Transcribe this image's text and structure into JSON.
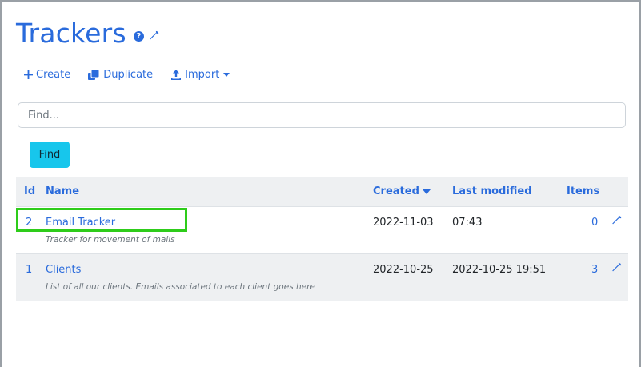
{
  "page": {
    "title": "Trackers",
    "help_icon": "question-circle-icon",
    "settings_icon": "wrench-icon"
  },
  "actions": [
    {
      "label": "Create",
      "icon": "plus-icon"
    },
    {
      "label": "Duplicate",
      "icon": "duplicate-icon"
    },
    {
      "label": "Import",
      "icon": "upload-icon"
    }
  ],
  "search": {
    "placeholder": "Find...",
    "value": ""
  },
  "find_button": {
    "label": "Find"
  },
  "table": {
    "headers": {
      "id": "Id",
      "name": "Name",
      "created": "Created",
      "last_modified": "Last modified",
      "items": "Items"
    },
    "rows": [
      {
        "id": "2",
        "name": "Email Tracker",
        "description": "Tracker for movement of mails",
        "created": "2022-11-03",
        "last_modified": "07:43",
        "items": "0"
      },
      {
        "id": "1",
        "name": "Clients",
        "description": "List of all our clients. Emails associated to each client goes here",
        "created": "2022-10-25",
        "last_modified": "2022-10-25 19:51",
        "items": "3"
      }
    ]
  },
  "colors": {
    "accent": "#2a6bdc",
    "find_button": "#17c6ec",
    "highlight": "#2ecc1a",
    "header_bg": "#eef0f2"
  }
}
